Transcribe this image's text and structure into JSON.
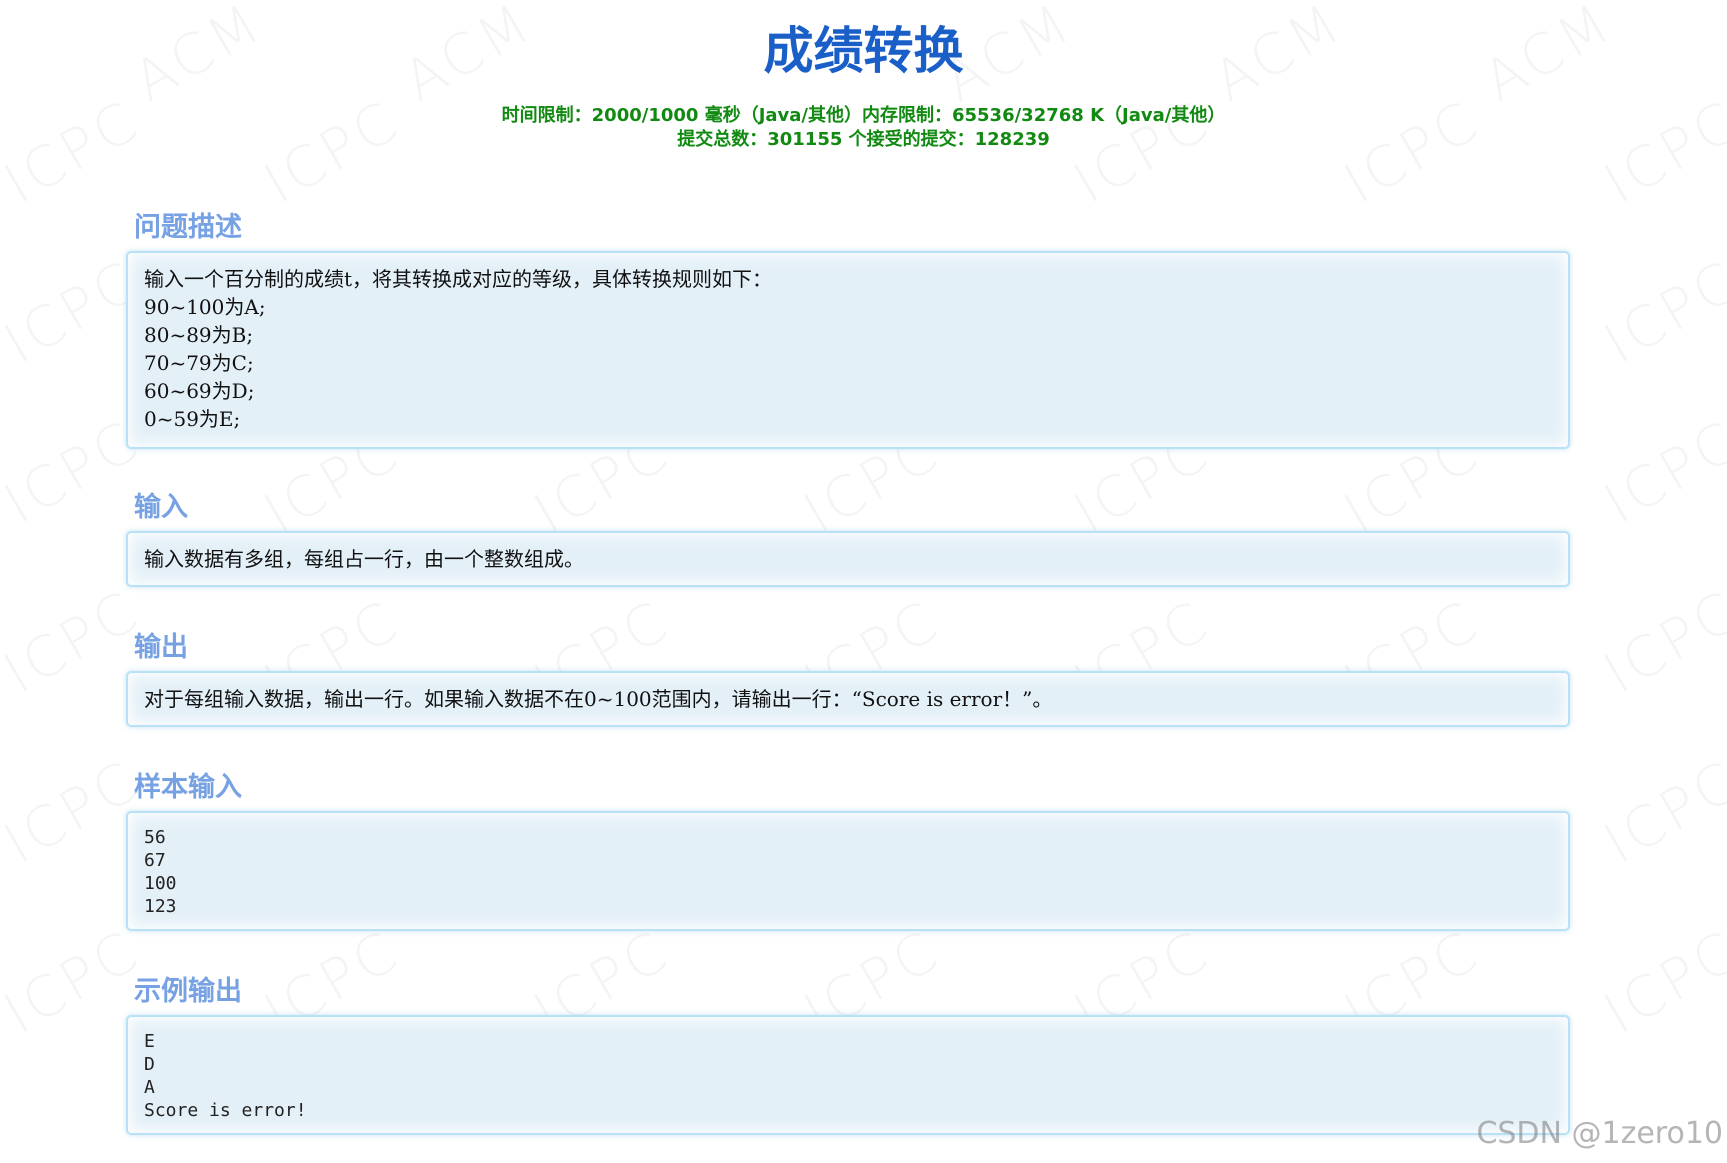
{
  "page": {
    "title": "成绩转换",
    "limits_line1": "时间限制：2000/1000 毫秒（Java/其他）内存限制：65536/32768 K（Java/其他）",
    "limits_line2": "提交总数：301155 个接受的提交：128239"
  },
  "watermark": {
    "text_a": "ACM",
    "text_b": "ICPC"
  },
  "sections": {
    "description": {
      "title": "问题描述",
      "lines": [
        "输入一个百分制的成绩t，将其转换成对应的等级，具体转换规则如下：",
        "90~100为A;",
        "80~89为B;",
        "70~79为C;",
        "60~69为D;",
        "0~59为E;"
      ]
    },
    "input": {
      "title": "输入",
      "text": "输入数据有多组，每组占一行，由一个整数组成。"
    },
    "output": {
      "title": "输出",
      "text": "对于每组输入数据，输出一行。如果输入数据不在0~100范围内，请输出一行：“Score is error！”。"
    },
    "sample_input": {
      "title": "样本输入",
      "lines": [
        "56",
        "67",
        "100",
        "123"
      ]
    },
    "sample_output": {
      "title": "示例输出",
      "lines": [
        "E",
        "D",
        "A",
        "Score is error!"
      ]
    }
  },
  "footer": {
    "watermark": "CSDN @1zero10"
  }
}
